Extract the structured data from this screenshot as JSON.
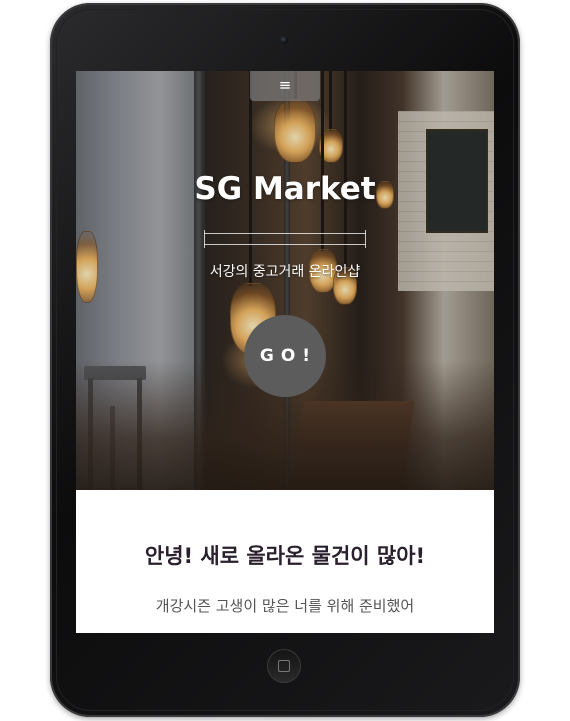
{
  "header": {
    "menu_icon": "hamburger-icon",
    "menu_glyph": "≡"
  },
  "hero": {
    "title": "SG Market",
    "tagline": "서강의 중고거래 온라인샵",
    "go_label": "GO!"
  },
  "intro": {
    "heading": "안녕! 새로 올라온 물건이 많아!",
    "subheading": "개강시즌 고생이 많은 너를 위해 준비했어"
  },
  "device": {
    "home_icon": "home-button-icon",
    "camera_icon": "camera-icon"
  },
  "colors": {
    "go_button": "#5c5c5c",
    "heading_text": "#2a1f2c",
    "subheading_text": "#555555"
  }
}
